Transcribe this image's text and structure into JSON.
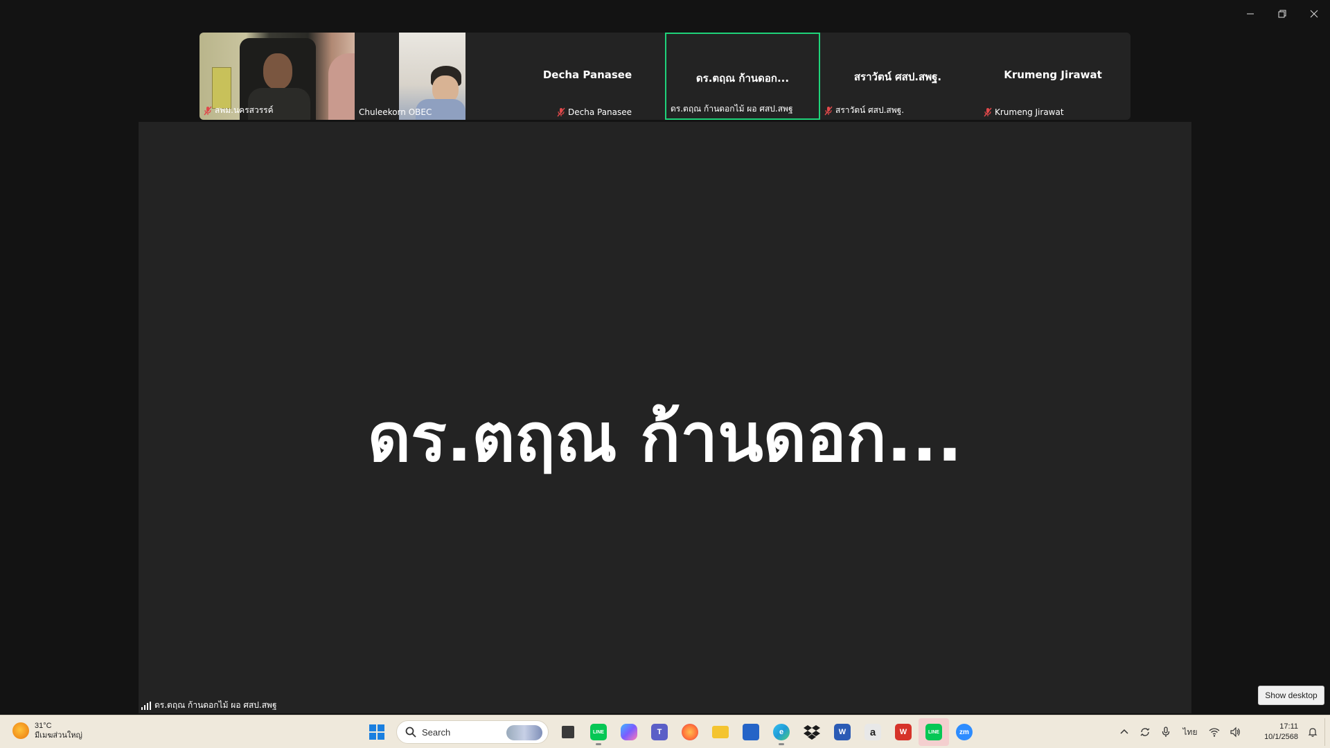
{
  "window": {
    "controls": [
      "minimize",
      "restore",
      "close"
    ]
  },
  "participants": [
    {
      "name": "สพม.นครสวรรค์",
      "muted": true,
      "video": true,
      "active": false
    },
    {
      "name": "Chuleekorn OBEC",
      "muted": false,
      "video": true,
      "active": false
    },
    {
      "display_name": "Decha Panasee",
      "name": "Decha Panasee",
      "muted": true,
      "video": false,
      "active": false
    },
    {
      "display_name": "ดร.ตฤณ ก้านดอก...",
      "name": "ดร.ตฤณ ก้านดอกไม้ ผอ ศสป.สพฐ",
      "muted": false,
      "video": false,
      "active": true
    },
    {
      "display_name": "สราวัตน์ ศสป.สพฐ.",
      "name": "สราวัตน์ ศสป.สพฐ.",
      "muted": true,
      "video": false,
      "active": false
    },
    {
      "display_name": "Krumeng Jirawat",
      "name": "Krumeng Jirawat",
      "muted": true,
      "video": false,
      "active": false
    }
  ],
  "stage": {
    "speaker_display": "ดร.ตฤณ ก้านดอก...",
    "speaker_label": "ดร.ตฤณ ก้านดอกไม้ ผอ ศสป.สพฐ"
  },
  "tooltip": {
    "show_desktop": "Show desktop"
  },
  "taskbar": {
    "weather": {
      "temp": "31°C",
      "condition": "มีเมฆส่วนใหญ่"
    },
    "search_label": "Search",
    "apps": [
      {
        "icon": "task-view-icon",
        "color": "#3a3a3a",
        "text": ""
      },
      {
        "icon": "line-icon",
        "color": "#06c755",
        "text": "LINE"
      },
      {
        "icon": "copilot-icon",
        "color": "#6c8cff",
        "text": ""
      },
      {
        "icon": "teams-icon",
        "color": "#5b5fc7",
        "text": "T"
      },
      {
        "icon": "firefox-icon",
        "color": "#ff7139",
        "text": ""
      },
      {
        "icon": "file-explorer-icon",
        "color": "#f4c430",
        "text": ""
      },
      {
        "icon": "store-icon",
        "color": "#2564c7",
        "text": ""
      },
      {
        "icon": "edge-icon",
        "color": "#1f9bd6",
        "text": "e"
      },
      {
        "icon": "dropbox-icon",
        "color": "#1b1b1b",
        "text": ""
      },
      {
        "icon": "word-icon",
        "color": "#2b5bb5",
        "text": "W"
      },
      {
        "icon": "amazon-icon",
        "color": "#e8e8e8",
        "text": "a"
      },
      {
        "icon": "wps-icon",
        "color": "#d6332a",
        "text": "W"
      },
      {
        "icon": "line-active-icon",
        "color": "#06c755",
        "text": "LINE"
      },
      {
        "icon": "zoom-icon",
        "color": "#2d8cff",
        "text": "zm"
      }
    ],
    "tray": {
      "language": "ไทย",
      "time": "17:11",
      "date": "10/1/2568"
    }
  },
  "colors": {
    "active_border": "#1fd37a",
    "stage_bg": "#232323",
    "window_bg": "#131313",
    "taskbar_bg": "#efe9dc",
    "mute_red": "#e0484a"
  }
}
